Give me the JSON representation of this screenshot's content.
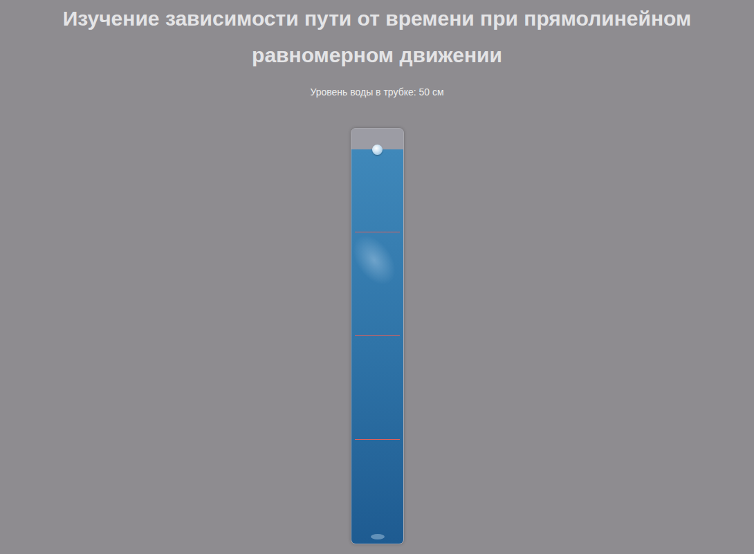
{
  "title": "Изучение зависимости пути от времени при прямолинейном равномерном движении",
  "water_label": "Уровень воды в трубке: 50 см",
  "tube": {
    "water": {
      "level": 0.95
    },
    "ball": {
      "level": 0.95
    }
  },
  "marks": [
    {
      "level": 0.75
    },
    {
      "level": 0.5
    },
    {
      "level": 0.25
    }
  ]
}
